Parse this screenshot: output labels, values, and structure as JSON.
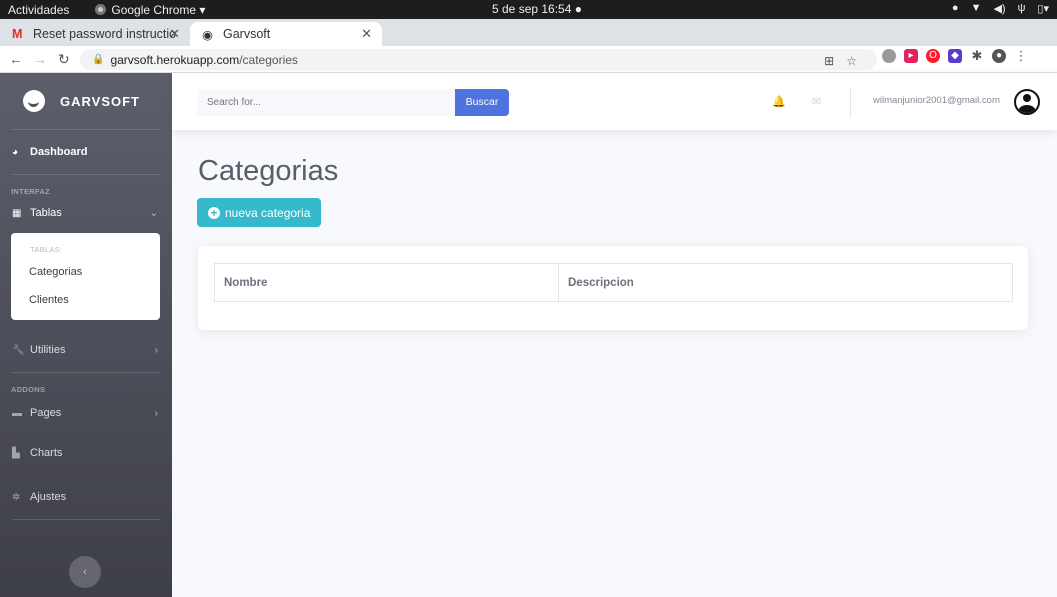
{
  "os_bar": {
    "activities": "Actividades",
    "app_name": "Google Chrome ▾",
    "clock": "5 de sep  16:54  ●"
  },
  "browser": {
    "tabs": [
      {
        "label": "Reset password instructio",
        "favicon": "gmail-icon"
      },
      {
        "label": "Garvsoft",
        "favicon": "globe-icon"
      }
    ],
    "url_domain": "garvsoft.herokuapp.com",
    "url_path": "/categories"
  },
  "sidebar": {
    "brand": "GARVSOFT",
    "dashboard": "Dashboard",
    "heading_interfaz": "INTERFAZ",
    "tablas": "Tablas",
    "submenu": {
      "heading": "TABLAS:",
      "items": [
        "Categorias",
        "Clientes"
      ]
    },
    "utilities": "Utilities",
    "heading_addons": "ADDONS",
    "pages": "Pages",
    "charts": "Charts",
    "ajustes": "Ajustes"
  },
  "topbar": {
    "search_placeholder": "Search for...",
    "search_button": "Buscar",
    "user_email": "wilmanjunior2001@gmail.com"
  },
  "main": {
    "title": "Categorias",
    "new_button": "nueva categoria",
    "table_headers": [
      "Nombre",
      "Descripcion"
    ]
  },
  "colors": {
    "primary": "#4e73df",
    "info": "#36b9cc"
  }
}
